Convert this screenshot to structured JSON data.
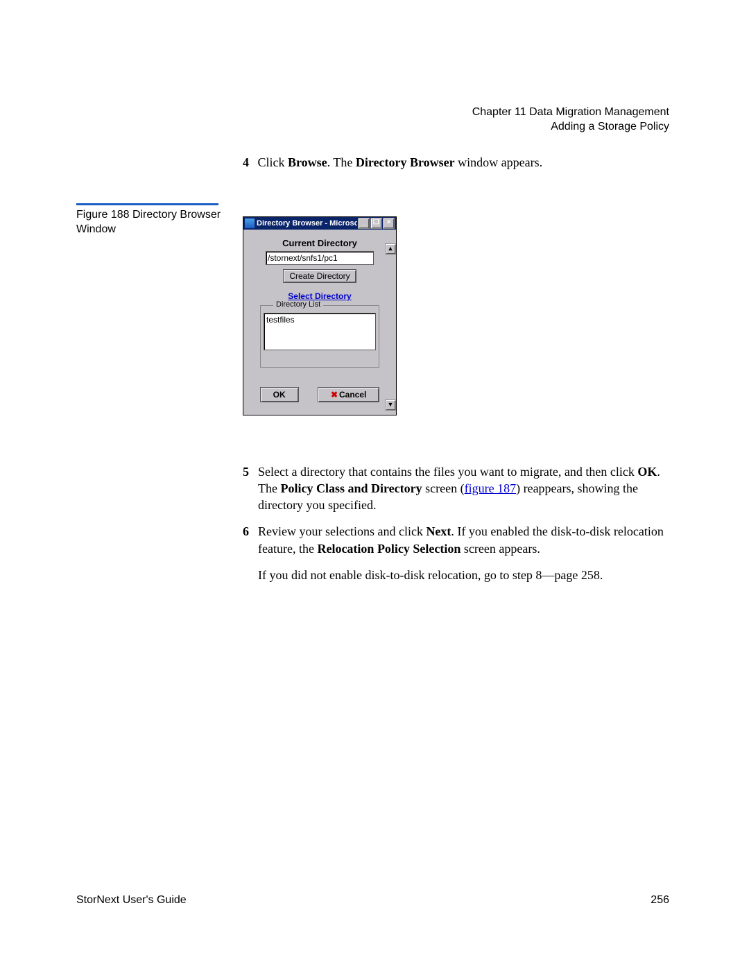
{
  "header": {
    "chapter_line": "Chapter 11  Data Migration Management",
    "section_line": "Adding a Storage Policy"
  },
  "step4": {
    "num": "4",
    "pre": "Click ",
    "browse": "Browse",
    "mid": ". The ",
    "dirbrowser": "Directory Browser",
    "post": " window appears."
  },
  "figure_caption": {
    "line1": "Figure 188  Directory Browser",
    "line2": "Window"
  },
  "dialog": {
    "title": "Directory Browser - Microsoft Int...",
    "current_dir_label": "Current Directory",
    "current_dir_value": "/stornext/snfs1/pc1",
    "create_btn": "Create Directory",
    "select_dir": "Select Directory",
    "list_legend": "Directory List",
    "list_item": "testfiles",
    "ok": "OK",
    "cancel": "Cancel",
    "min": "_",
    "restore": "❐",
    "close": "×",
    "up": "▲",
    "down": "▼"
  },
  "step5": {
    "num": "5",
    "t1": "Select a directory that contains the files you want to migrate, and then click ",
    "ok_bold": "OK",
    "t2": ". The ",
    "pcd_bold": "Policy Class and Directory",
    "t3": " screen (",
    "link": "figure 187",
    "t4": ") reappears, showing the directory you specified."
  },
  "step6": {
    "num": "6",
    "t1": "Review your selections and click ",
    "next_bold": "Next",
    "t2": ". If you enabled the disk-to-disk relocation feature, the ",
    "rps_bold": "Relocation Policy Selection",
    "t3": " screen appears."
  },
  "after": "If you did not enable disk-to-disk relocation, go to step 8—page 258.",
  "footer": {
    "left": "StorNext User's Guide",
    "right": "256"
  }
}
